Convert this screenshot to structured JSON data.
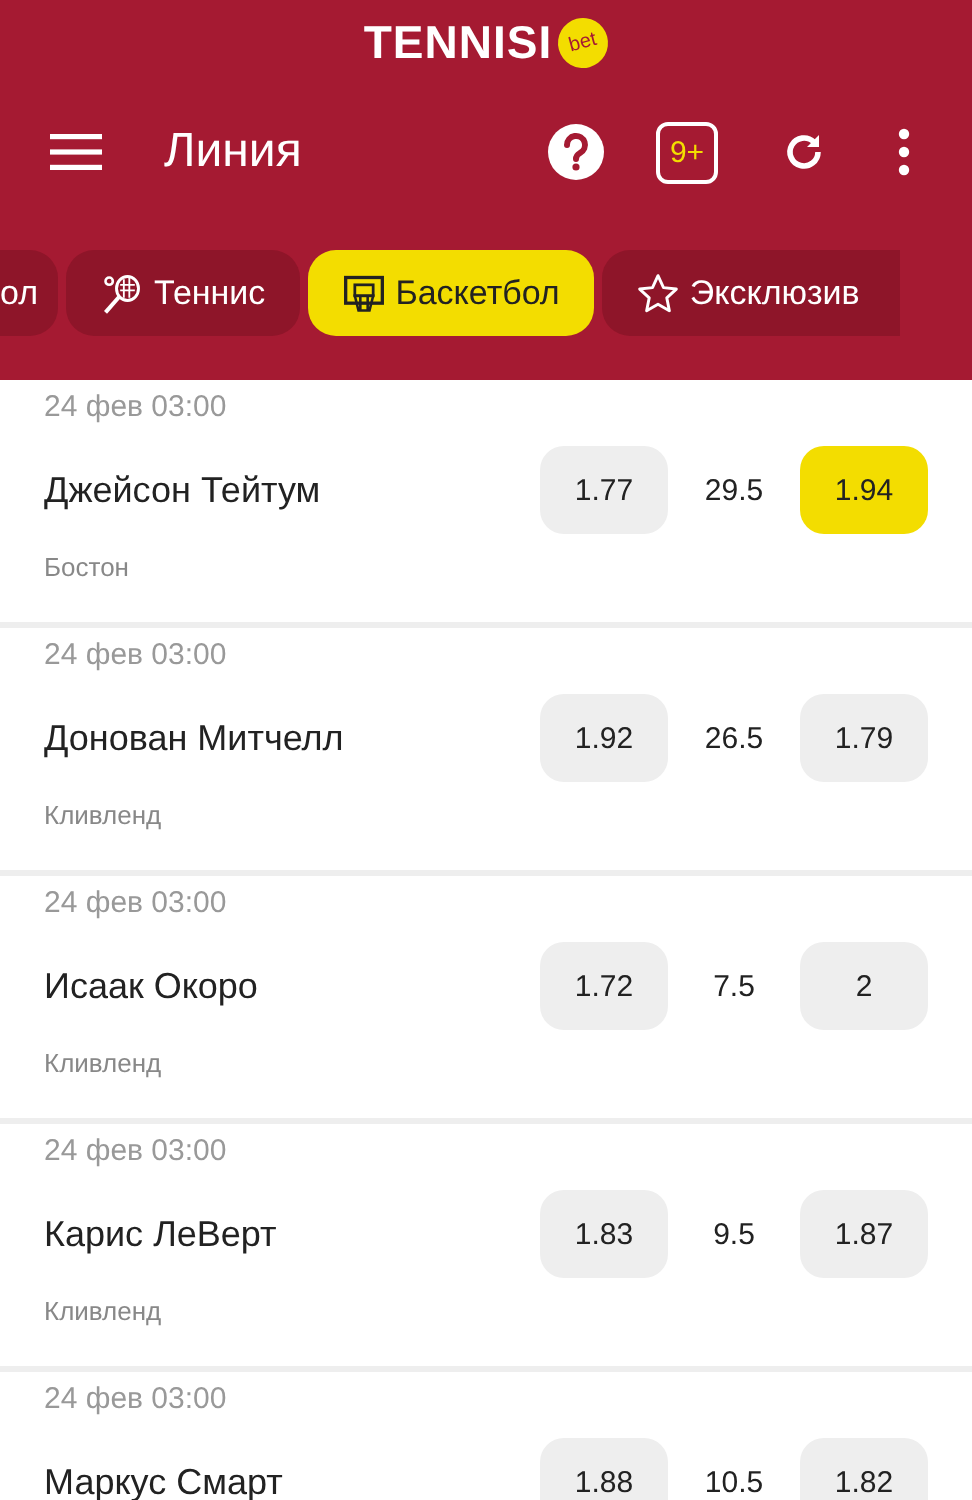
{
  "header": {
    "logo": "TENNISI",
    "logo_badge": "bet",
    "title": "Линия",
    "coupon_badge": "9+"
  },
  "tabs": [
    {
      "label": "ол",
      "kind": "text",
      "selected": false
    },
    {
      "label": "Теннис",
      "kind": "racket",
      "selected": false
    },
    {
      "label": "Баскетбол",
      "kind": "basket",
      "selected": true
    },
    {
      "label": "Эксклюзив",
      "kind": "star",
      "selected": false
    }
  ],
  "rows": [
    {
      "date": "24 фев 03:00",
      "player": "Джейсон Тейтум",
      "team": "Бостон",
      "odds": [
        {
          "value": "1.77",
          "selected": false
        },
        {
          "value": "1.94",
          "selected": true
        }
      ],
      "line": "29.5"
    },
    {
      "date": "24 фев 03:00",
      "player": "Донован Митчелл",
      "team": "Кливленд",
      "odds": [
        {
          "value": "1.92",
          "selected": false
        },
        {
          "value": "1.79",
          "selected": false
        }
      ],
      "line": "26.5"
    },
    {
      "date": "24 фев 03:00",
      "player": "Исаак Окоро",
      "team": "Кливленд",
      "odds": [
        {
          "value": "1.72",
          "selected": false
        },
        {
          "value": "2",
          "selected": false
        }
      ],
      "line": "7.5"
    },
    {
      "date": "24 фев 03:00",
      "player": "Карис ЛеВерт",
      "team": "Кливленд",
      "odds": [
        {
          "value": "1.83",
          "selected": false
        },
        {
          "value": "1.87",
          "selected": false
        }
      ],
      "line": "9.5"
    },
    {
      "date": "24 фев 03:00",
      "player": "Маркус Смарт",
      "odds": [
        {
          "value": "1.88",
          "selected": false
        },
        {
          "value": "1.82",
          "selected": false
        }
      ],
      "line": "10.5"
    }
  ]
}
